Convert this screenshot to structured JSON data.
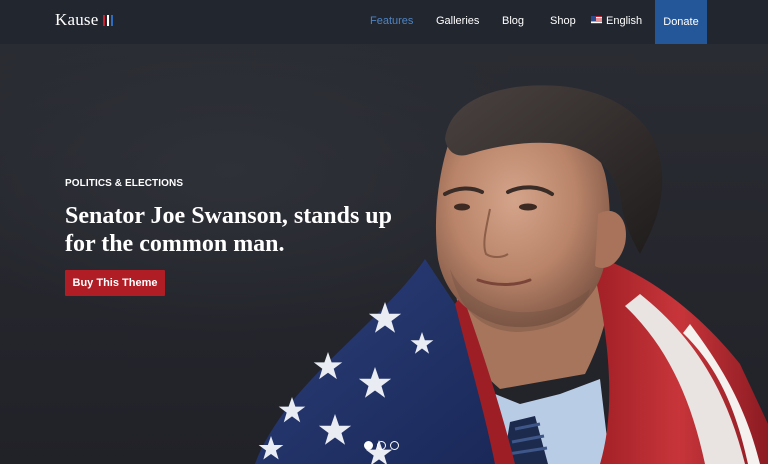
{
  "header": {
    "logo": {
      "text": "Kause",
      "mark_colors": [
        "#c8202f",
        "#ffffff",
        "#2f6bc0"
      ]
    },
    "nav": [
      {
        "label": "Features",
        "active": true
      },
      {
        "label": "Galleries",
        "active": false
      },
      {
        "label": "Blog",
        "active": false
      },
      {
        "label": "Shop",
        "active": false
      },
      {
        "label": "English",
        "icon": "us-flag-icon",
        "active": false
      }
    ],
    "donate_label": "Donate"
  },
  "hero": {
    "eyebrow": "POLITICS & ELECTIONS",
    "headline_line1": "Senator Joe Swanson, stands up",
    "headline_line2": "for the common man.",
    "cta_label": "Buy This Theme",
    "slider": {
      "count": 3,
      "active_index": 0
    },
    "photo_icon": "senator-portrait-with-flag-image"
  },
  "colors": {
    "header_bg": "#22262f",
    "hero_bg": "#23252c",
    "nav_active": "#4d84c4",
    "donate_bg": "#24579a",
    "cta_bg": "#b11d24"
  }
}
